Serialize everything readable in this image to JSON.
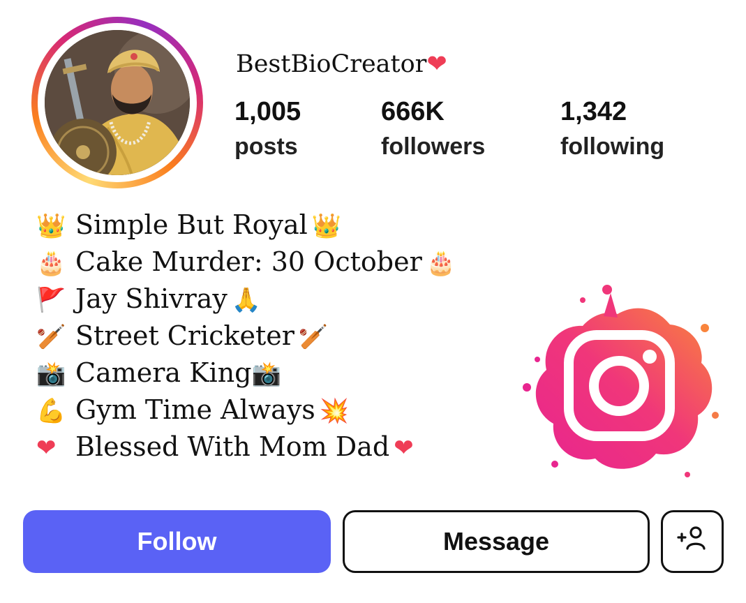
{
  "profile": {
    "username": "BestBioCreator",
    "username_emoji": "❤"
  },
  "stats": [
    {
      "count": "1,005",
      "label": "posts"
    },
    {
      "count": "666K",
      "label": "followers"
    },
    {
      "count": "1,342",
      "label": "following"
    }
  ],
  "bio": [
    {
      "lead": "👑",
      "text": "Simple But Royal",
      "tail": "👑"
    },
    {
      "lead": "🎂",
      "text": "Cake Murder: 30 October",
      "tail": "🎂"
    },
    {
      "lead": "🚩",
      "text": "Jay Shivray",
      "tail": "🙏"
    },
    {
      "lead": "🏏",
      "text": "Street Cricketer",
      "tail": "🏏"
    },
    {
      "lead": "📸",
      "text": "Camera King",
      "tail": "📸"
    },
    {
      "lead": "💪",
      "text": "Gym Time Always",
      "tail": "💥"
    },
    {
      "lead": "❤",
      "text": "Blessed With Mom Dad",
      "tail": "❤"
    }
  ],
  "buttons": {
    "follow": "Follow",
    "message": "Message"
  },
  "icons": {
    "avatar": "profile-photo-icon",
    "logo": "instagram-logo-icon",
    "add_user": "add-user-icon"
  },
  "colors": {
    "follow_button": "#5a62f5",
    "heart": "#ef3d56",
    "ring_gradient": [
      "#feda75",
      "#fa7e1e",
      "#d62976",
      "#962fbf"
    ]
  }
}
